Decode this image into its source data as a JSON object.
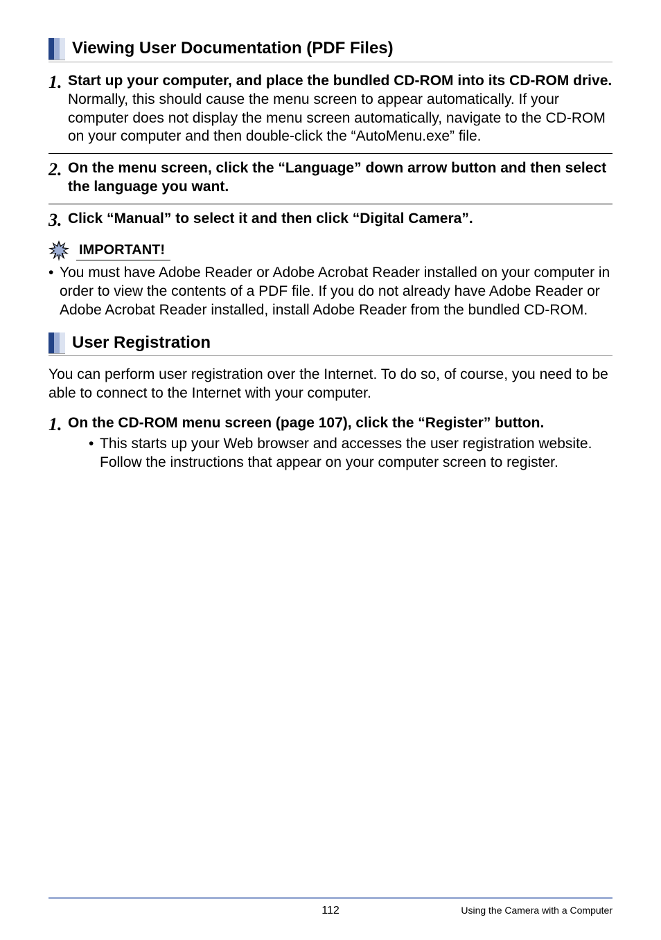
{
  "section1": {
    "heading": "Viewing User Documentation (PDF Files)",
    "step1": {
      "num": "1.",
      "title": "Start up your computer, and place the bundled CD-ROM into its CD-ROM drive.",
      "desc": "Normally, this should cause the menu screen to appear automatically. If your computer does not display the menu screen automatically, navigate to the CD-ROM on your computer and then double-click the “AutoMenu.exe” file."
    },
    "step2": {
      "num": "2.",
      "title": "On the menu screen, click the “Language” down arrow button and then select the language you want."
    },
    "step3": {
      "num": "3.",
      "title": "Click “Manual” to select it and then click “Digital Camera”."
    },
    "important_label": "IMPORTANT!",
    "important_bullet": "You must have Adobe Reader or Adobe Acrobat Reader installed on your computer in order to view the contents of a PDF file. If you do not already have Adobe Reader or Adobe Acrobat Reader installed, install Adobe Reader from the bundled CD-ROM."
  },
  "section2": {
    "heading": "User Registration",
    "intro": "You can perform user registration over the Internet. To do so, of course, you need to be able to connect to the Internet with your computer.",
    "step1": {
      "num": "1.",
      "title": "On the CD-ROM menu screen (page 107), click the “Register” button.",
      "sub": "This starts up your Web browser and accesses the user registration website. Follow the instructions that appear on your computer screen to register."
    }
  },
  "footer": {
    "page_num": "112",
    "right": "Using the Camera with a Computer"
  }
}
